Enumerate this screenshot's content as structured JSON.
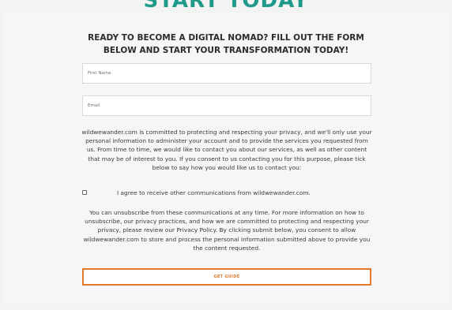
{
  "hero": {
    "title": "START TODAY"
  },
  "form": {
    "heading": "READY TO BECOME A DIGITAL NOMAD? FILL OUT THE FORM BELOW AND START YOUR TRANSFORMATION TODAY!",
    "first_name_placeholder": "First Name",
    "email_placeholder": "Email",
    "privacy_notice": "wildwewander.com is committed to protecting and respecting your privacy, and we'll only use your personal information to administer your account and to provide the services you requested from us. From time to time, we would like to contact you about our services, as well as other content that may be of interest to you. If you consent to us contacting you for this purpose, please tick below to say how you would like us to contact you:",
    "consent_label": "I agree to receive other communications from wildwewander.com.",
    "consent_checked": false,
    "unsubscribe_notice": "You can unsubscribe from these communications at any time. For more information on how to unsubscribe, our privacy practices, and how we are committed to protecting and respecting your privacy, please review our Privacy Policy. By clicking submit below, you consent to allow wildwewander.com to store and process the personal information submitted above to provide you the content requested.",
    "submit_label": "GET GUIDE"
  },
  "colors": {
    "title_teal": "#1f9a8a",
    "accent_orange": "#e07a2a",
    "background": "#f3f3f3"
  }
}
